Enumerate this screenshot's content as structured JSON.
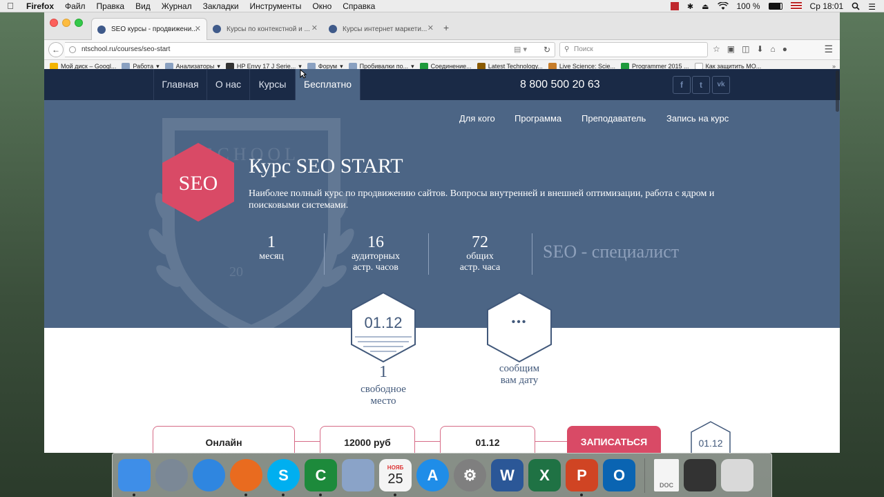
{
  "menubar": {
    "app": "Firefox",
    "items": [
      "Файл",
      "Правка",
      "Вид",
      "Журнал",
      "Закладки",
      "Инструменты",
      "Окно",
      "Справка"
    ],
    "battery": "100 %",
    "clock": "Ср 18:01"
  },
  "tabs": [
    {
      "title": "SEO курсы - продвижени..."
    },
    {
      "title": "Курсы по контекстной и ..."
    },
    {
      "title": "Курсы интернет маркети..."
    }
  ],
  "navbar": {
    "url": "ntschool.ru/courses/seo-start",
    "search_placeholder": "Поиск"
  },
  "bookmarks": [
    {
      "label": "Мой диск – Googl...",
      "color": "#f3b400"
    },
    {
      "label": "Работа",
      "color": "#8aa1c1"
    },
    {
      "label": "Анализаторы",
      "color": "#8aa1c1"
    },
    {
      "label": "HP Envy 17 J Serie...",
      "color": "#333333"
    },
    {
      "label": "Форум",
      "color": "#8aa1c1"
    },
    {
      "label": "Пробивалки по...",
      "color": "#8aa1c1"
    },
    {
      "label": "Соединение...",
      "color": "#1e9a3c"
    },
    {
      "label": "Latest Technology...",
      "color": "#8a5a00"
    },
    {
      "label": "Live Science: Scie...",
      "color": "#c77d2a"
    },
    {
      "label": "Programmer 2015 ...",
      "color": "#1e9a3c"
    },
    {
      "label": "Как защитить МО...",
      "color": "#cccccc"
    }
  ],
  "site": {
    "nav": [
      "Главная",
      "О нас",
      "Курсы",
      "Бесплатно"
    ],
    "phone": "8 800 500 20 63",
    "social": [
      "f",
      "t",
      "vk"
    ],
    "anchors": [
      "Для кого",
      "Программа",
      "Преподаватель",
      "Запись на курс"
    ],
    "badge": "SEO",
    "title": "Курс SEO START",
    "description": "Наиболее полный курс по продвижению сайтов. Вопросы внутренней и внешней оптимизации, работа с ядром и поисковыми системами.",
    "stats": [
      {
        "num": "1",
        "label1": "месяц",
        "label2": ""
      },
      {
        "num": "16",
        "label1": "аудиторных",
        "label2": "астр. часов"
      },
      {
        "num": "72",
        "label1": "общих",
        "label2": "астр. часа"
      }
    ],
    "specialist": "SEO - специалист",
    "watermark": {
      "school": "SCHOOL",
      "year": "20"
    },
    "date1": {
      "date": "01.12",
      "count": "1",
      "line1": "свободное",
      "line2": "место"
    },
    "date2": {
      "dots": "•••",
      "line1": "сообщим",
      "line2": "вам дату"
    },
    "bottom": {
      "format": "Онлайн",
      "price": "12000 руб",
      "date": "01.12",
      "cta": "ЗАПИСАТЬСЯ",
      "next_date": "01.12"
    }
  },
  "colors": {
    "hero": "#4c6585",
    "nav": "#1a2a46",
    "accent": "#d94a66"
  },
  "dock": [
    {
      "name": "finder",
      "glyph": "",
      "color": "#3e8ee8"
    },
    {
      "name": "launchpad",
      "glyph": "",
      "color": "#7b8896"
    },
    {
      "name": "safari",
      "glyph": "",
      "color": "#2f86e0"
    },
    {
      "name": "firefox",
      "glyph": "",
      "color": "#e96b1f"
    },
    {
      "name": "skype",
      "glyph": "S",
      "color": "#00aff0"
    },
    {
      "name": "camtasia",
      "glyph": "C",
      "color": "#1d8a3b"
    },
    {
      "name": "preview",
      "glyph": "",
      "color": "#8aa3c8"
    },
    {
      "name": "calendar",
      "glyph": "25",
      "color": "#f4f4f4",
      "month": "НОЯБ"
    },
    {
      "name": "app-store",
      "glyph": "A",
      "color": "#1f8de8"
    },
    {
      "name": "system-preferences",
      "glyph": "⚙",
      "color": "#7f7f7f"
    },
    {
      "name": "word",
      "glyph": "W",
      "color": "#2b5797"
    },
    {
      "name": "excel",
      "glyph": "X",
      "color": "#1f7244"
    },
    {
      "name": "powerpoint",
      "glyph": "P",
      "color": "#d04423"
    },
    {
      "name": "outlook",
      "glyph": "O",
      "color": "#0a64b2"
    }
  ],
  "dock_right": [
    {
      "name": "document",
      "glyph": "DOC",
      "color": "#f4f4f4"
    },
    {
      "name": "screen-recorder",
      "glyph": "",
      "color": "#333333"
    },
    {
      "name": "trash",
      "glyph": "",
      "color": "#d9d9d9"
    }
  ]
}
